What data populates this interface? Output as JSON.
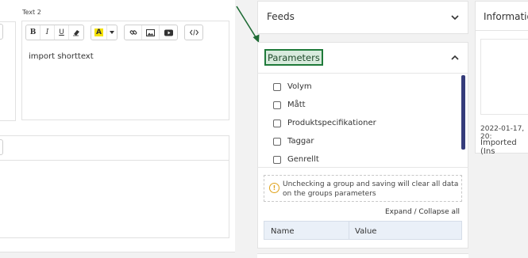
{
  "editor": {
    "text2_label": "Text 2",
    "text2_value": "import shorttext",
    "toolbar": {
      "bold": "B",
      "italic": "I",
      "underline": "U",
      "highlight": "A"
    }
  },
  "feeds": {
    "title": "Feeds"
  },
  "parameters": {
    "title": "Parameters",
    "groups": [
      "Volym",
      "Mått",
      "Produktspecifikationer",
      "Taggar",
      "Genrellt"
    ],
    "warning": "Unchecking a group and saving will clear all data on the groups parameters",
    "expand_collapse": "Expand / Collapse all",
    "columns": [
      "Name",
      "Value"
    ]
  },
  "information": {
    "title": "Informatio",
    "timestamp": "2022-01-17, 20:",
    "status": "Imported (Ins"
  },
  "colors": {
    "accent_dark": "#353c7a",
    "highlight_green": "#1f7a3a",
    "highlight_fill": "#d8ebdd",
    "warning": "#e0a21a"
  }
}
